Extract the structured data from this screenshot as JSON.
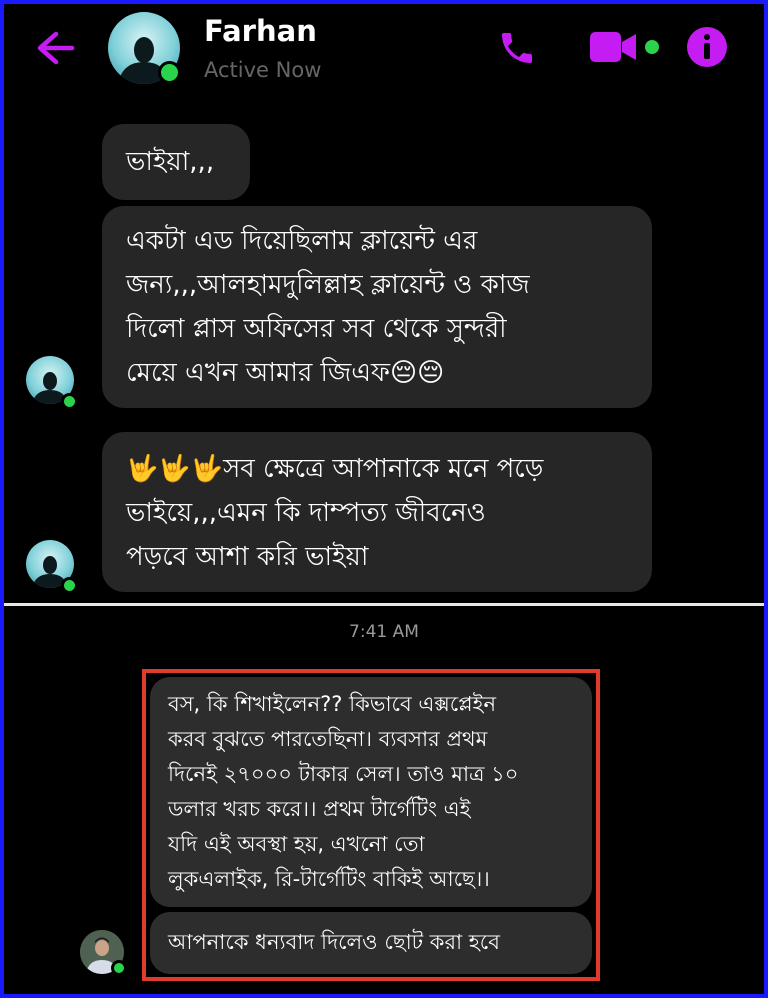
{
  "header": {
    "contact_name": "Farhan",
    "status": "Active Now",
    "icons": {
      "back": "back-arrow-icon",
      "call": "phone-icon",
      "video": "video-camera-icon",
      "info": "info-icon"
    },
    "accent_color": "#c41cf2",
    "online_color": "#2bd34a"
  },
  "incoming": {
    "messages": [
      {
        "text": "ভাইয়া,,,"
      },
      {
        "lines": [
          "একটা এড দিয়েছিলাম ক্লায়েন্ট এর",
          "জন্য,,,আলহামদুলিল্লাহ ক্লায়েন্ট ও কাজ",
          "দিলো প্লাস অফিসের সব থেকে সুন্দরী",
          "মেয়ে এখন আমার জিএফ😔😔"
        ]
      },
      {
        "lines": [
          "🤟🤟🤟সব ক্ষেত্রে আপানাকে মনে পড়ে",
          "ভাইয়ে,,,এমন কি দাম্পত্য জীবনেও",
          "পড়বে আশা করি ভাইয়া"
        ]
      }
    ],
    "bubble_color": "#262626"
  },
  "timestamp": "7:41 AM",
  "outgoing": {
    "messages": [
      {
        "lines": [
          "বস, কি শিখাইলেন?? কিভাবে এক্সপ্লেইন",
          "করব বুঝতে পারতেছিনা। ব্যবসার প্রথম",
          "দিনেই ২৭০০০ টাকার সেল। তাও মাত্র ১০",
          "ডলার খরচ করে।। প্রথম টার্গেটিং এই",
          "যদি এই অবস্থা হয়, এখনো তো",
          "লুকএলাইক, রি-টার্গেটিং বাকিই আছে।।"
        ]
      },
      {
        "text": "আপনাকে ধন্যবাদ দিলেও ছোট করা হবে"
      }
    ],
    "highlight_color": "#e23b2e"
  }
}
